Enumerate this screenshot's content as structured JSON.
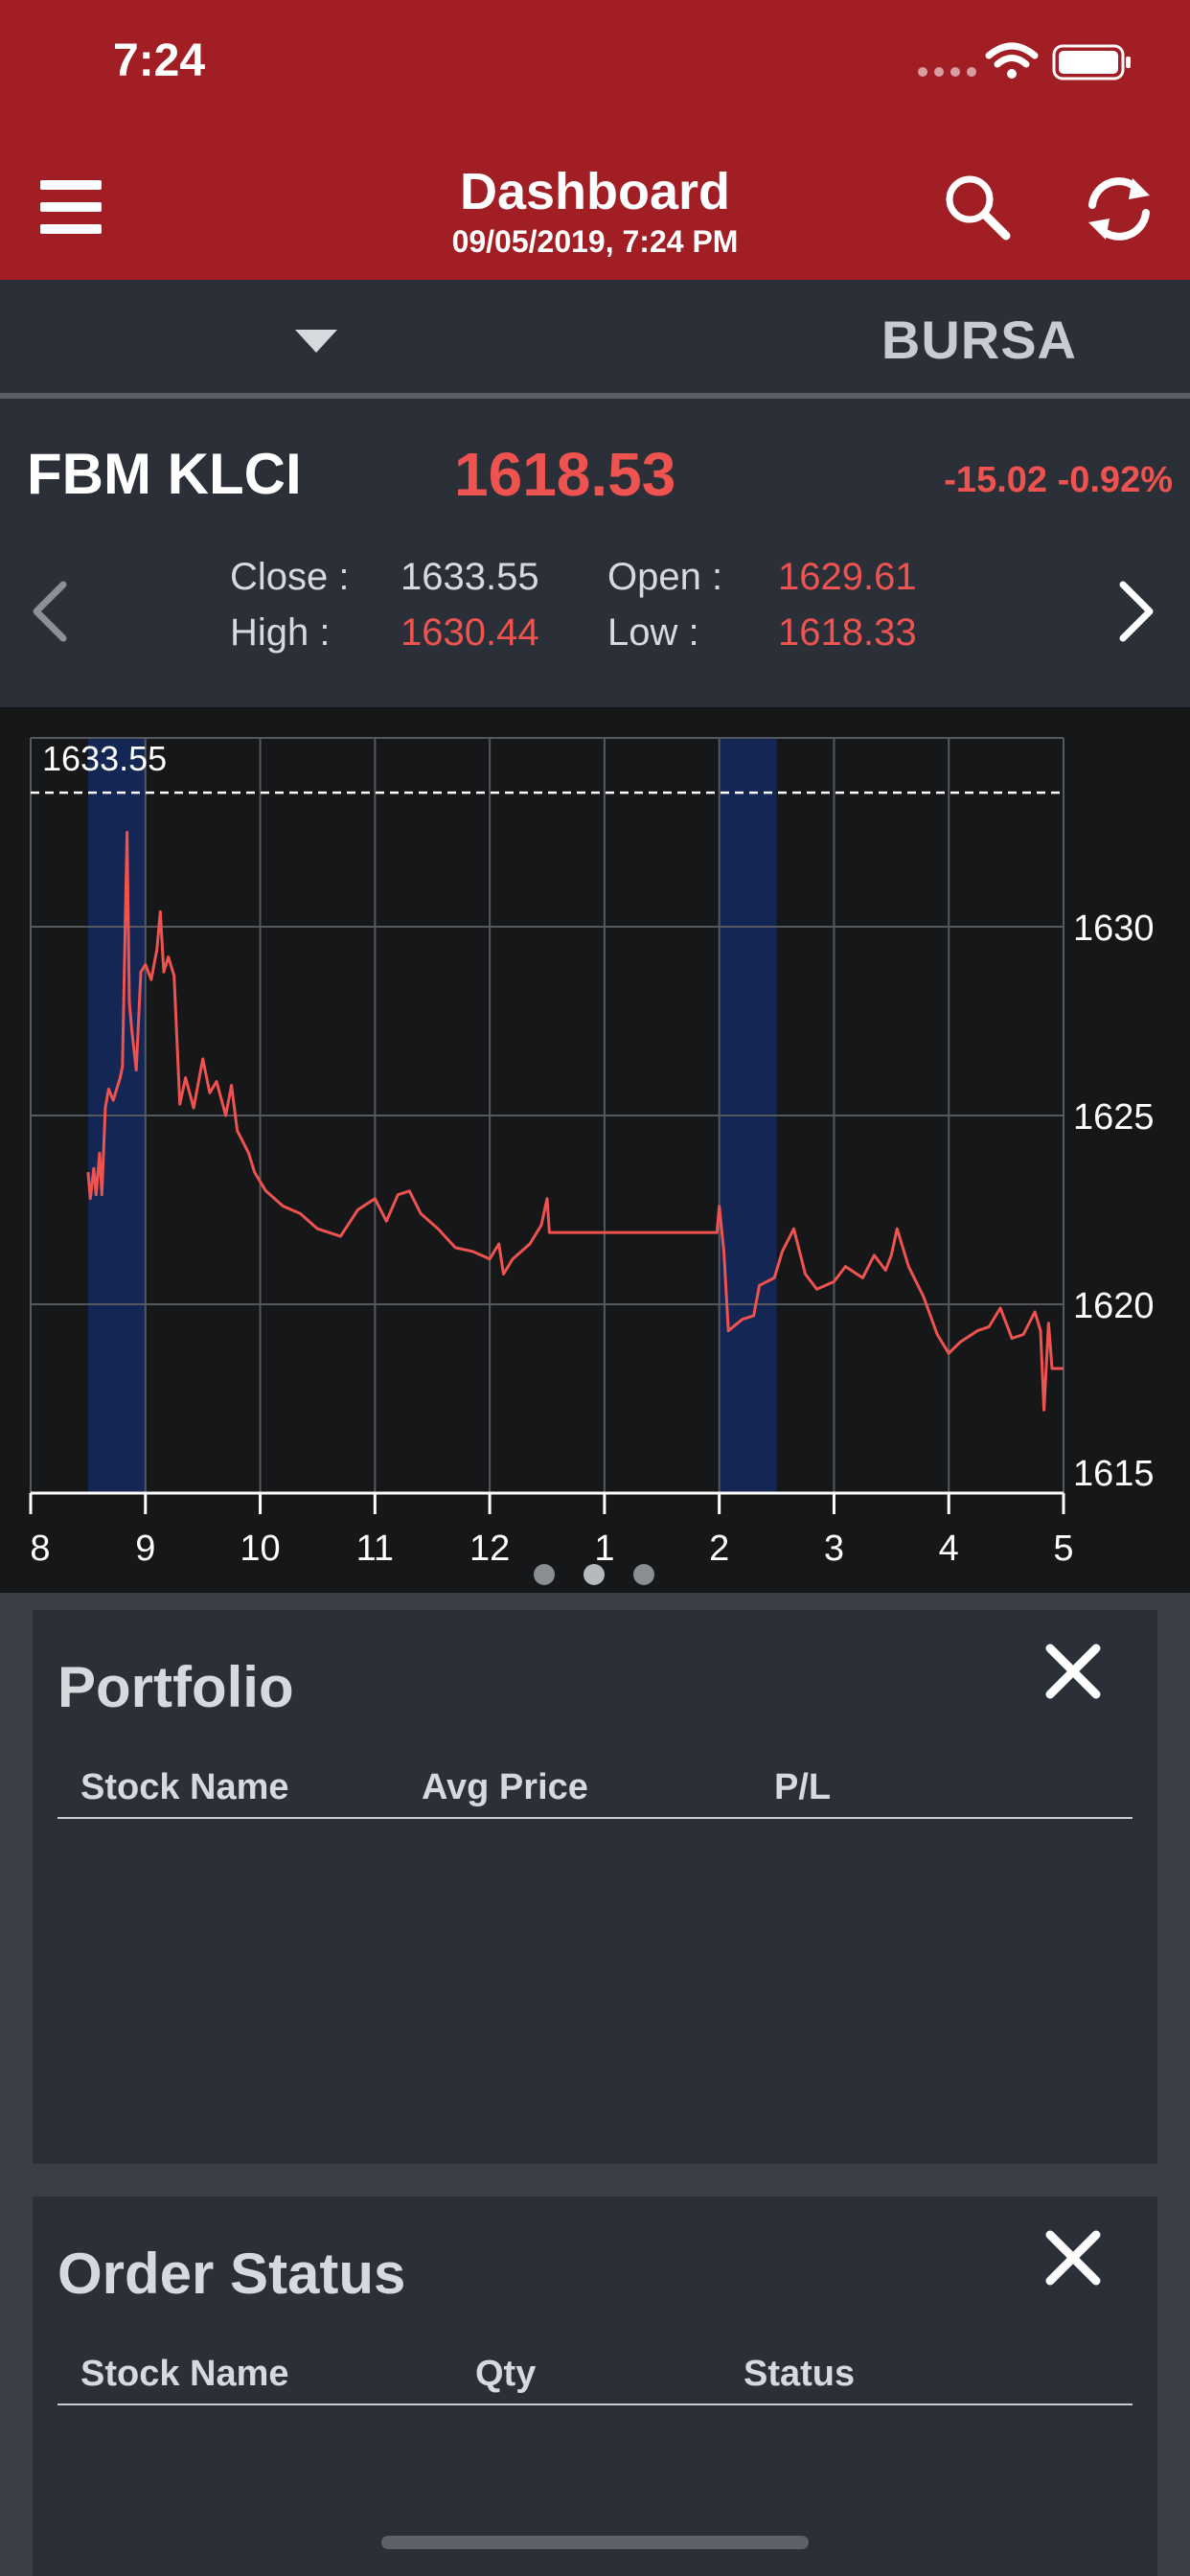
{
  "status_bar": {
    "time": "7:24"
  },
  "header": {
    "title": "Dashboard",
    "subtitle": "09/05/2019, 7:24 PM"
  },
  "market": {
    "selected": "BURSA"
  },
  "index": {
    "name": "FBM KLCI",
    "value": "1618.53",
    "change": "-15.02 -0.92%",
    "close_label": "Close :",
    "close": "1633.55",
    "open_label": "Open :",
    "open": "1629.61",
    "high_label": "High :",
    "high": "1630.44",
    "low_label": "Low :",
    "low": "1618.33"
  },
  "colors": {
    "header": "#a11e24",
    "panel": "#2b3038",
    "up_down_red": "#ef5350",
    "session_band": "#142654"
  },
  "chart_data": {
    "type": "line",
    "prev_close": 1633.55,
    "prev_close_label": "1633.55",
    "ylim": [
      1615,
      1635
    ],
    "y_ticks": [
      1615,
      1620,
      1625,
      1630
    ],
    "x_ticks": [
      "8",
      "9",
      "10",
      "11",
      "12",
      "1",
      "2",
      "3",
      "4",
      "5"
    ],
    "grid": true,
    "highlight_bands": [
      [
        8.5,
        9.0
      ],
      [
        14.0,
        14.5
      ]
    ],
    "series": [
      {
        "points": [
          [
            8.5,
            1623.5
          ],
          [
            8.52,
            1622.8
          ],
          [
            8.55,
            1623.6
          ],
          [
            8.57,
            1622.9
          ],
          [
            8.6,
            1624.0
          ],
          [
            8.62,
            1622.9
          ],
          [
            8.65,
            1625.2
          ],
          [
            8.68,
            1625.7
          ],
          [
            8.72,
            1625.4
          ],
          [
            8.78,
            1626.0
          ],
          [
            8.8,
            1626.3
          ],
          [
            8.84,
            1632.5
          ],
          [
            8.86,
            1628.0
          ],
          [
            8.88,
            1627.3
          ],
          [
            8.92,
            1626.2
          ],
          [
            8.96,
            1628.8
          ],
          [
            9.0,
            1629.0
          ],
          [
            9.05,
            1628.6
          ],
          [
            9.1,
            1629.4
          ],
          [
            9.13,
            1630.4
          ],
          [
            9.16,
            1628.8
          ],
          [
            9.2,
            1629.2
          ],
          [
            9.25,
            1628.7
          ],
          [
            9.3,
            1625.3
          ],
          [
            9.35,
            1626.0
          ],
          [
            9.42,
            1625.2
          ],
          [
            9.5,
            1626.5
          ],
          [
            9.56,
            1625.6
          ],
          [
            9.62,
            1625.9
          ],
          [
            9.7,
            1625.0
          ],
          [
            9.75,
            1625.8
          ],
          [
            9.8,
            1624.6
          ],
          [
            9.9,
            1624.0
          ],
          [
            9.95,
            1623.5
          ],
          [
            10.05,
            1623.0
          ],
          [
            10.2,
            1622.6
          ],
          [
            10.35,
            1622.4
          ],
          [
            10.5,
            1622.0
          ],
          [
            10.7,
            1621.8
          ],
          [
            10.85,
            1622.5
          ],
          [
            11.0,
            1622.8
          ],
          [
            11.1,
            1622.2
          ],
          [
            11.2,
            1622.9
          ],
          [
            11.3,
            1623.0
          ],
          [
            11.4,
            1622.4
          ],
          [
            11.55,
            1622.0
          ],
          [
            11.7,
            1621.5
          ],
          [
            11.85,
            1621.4
          ],
          [
            12.0,
            1621.2
          ],
          [
            12.08,
            1621.6
          ],
          [
            12.12,
            1620.8
          ],
          [
            12.2,
            1621.2
          ],
          [
            12.35,
            1621.6
          ],
          [
            12.45,
            1622.1
          ],
          [
            12.5,
            1622.8
          ],
          [
            12.52,
            1621.9
          ],
          [
            13.0,
            1621.9
          ],
          [
            13.5,
            1621.9
          ],
          [
            13.98,
            1621.9
          ],
          [
            14.0,
            1622.6
          ],
          [
            14.04,
            1621.4
          ],
          [
            14.08,
            1619.3
          ],
          [
            14.2,
            1619.6
          ],
          [
            14.3,
            1619.7
          ],
          [
            14.35,
            1620.5
          ],
          [
            14.48,
            1620.7
          ],
          [
            14.55,
            1621.4
          ],
          [
            14.65,
            1622.0
          ],
          [
            14.75,
            1620.8
          ],
          [
            14.85,
            1620.4
          ],
          [
            15.0,
            1620.6
          ],
          [
            15.1,
            1621.0
          ],
          [
            15.25,
            1620.7
          ],
          [
            15.35,
            1621.3
          ],
          [
            15.45,
            1620.9
          ],
          [
            15.5,
            1621.3
          ],
          [
            15.55,
            1622.0
          ],
          [
            15.65,
            1621.0
          ],
          [
            15.78,
            1620.2
          ],
          [
            15.9,
            1619.2
          ],
          [
            16.0,
            1618.7
          ],
          [
            16.1,
            1619.0
          ],
          [
            16.25,
            1619.3
          ],
          [
            16.35,
            1619.4
          ],
          [
            16.45,
            1619.9
          ],
          [
            16.55,
            1619.1
          ],
          [
            16.65,
            1619.2
          ],
          [
            16.75,
            1619.8
          ],
          [
            16.8,
            1619.3
          ],
          [
            16.83,
            1617.2
          ],
          [
            16.87,
            1619.5
          ],
          [
            16.9,
            1618.3
          ],
          [
            17.0,
            1618.3
          ]
        ]
      }
    ]
  },
  "portfolio": {
    "title": "Portfolio",
    "columns": [
      "Stock Name",
      "Avg Price",
      "P/L"
    ]
  },
  "order_status": {
    "title": "Order Status",
    "columns": [
      "Stock Name",
      "Qty",
      "Status"
    ]
  }
}
